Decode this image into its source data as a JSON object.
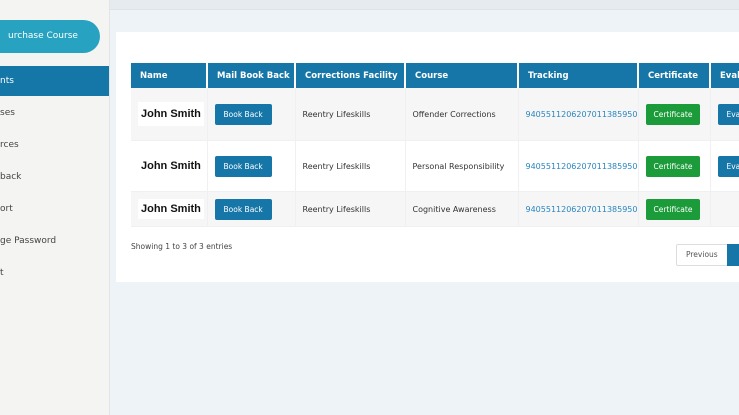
{
  "sidebar": {
    "purchase_label": "urchase Course",
    "items": [
      {
        "label": "nts",
        "active": true
      },
      {
        "label": "ses",
        "active": false
      },
      {
        "label": "rces",
        "active": false
      },
      {
        "label": "back",
        "active": false
      },
      {
        "label": "ort",
        "active": false
      },
      {
        "label": "ge Password",
        "active": false
      },
      {
        "label": "t",
        "active": false
      }
    ]
  },
  "table": {
    "headers": [
      "Name",
      "Mail Book Back",
      "Corrections Facility",
      "Course",
      "Tracking",
      "Certificate",
      "Eval"
    ],
    "rows": [
      {
        "name": "John Smith",
        "book_back": "Book Back",
        "facility": "Reentry Lifeskills",
        "course": "Offender Corrections",
        "tracking": "9405511206207011385950",
        "certificate": "Certificate",
        "eval": "Eval"
      },
      {
        "name": "John Smith",
        "book_back": "Book Back",
        "facility": "Reentry Lifeskills",
        "course": "Personal Responsibility",
        "tracking": "9405511206207011385950",
        "certificate": "Certificate",
        "eval": "Eval"
      },
      {
        "name": "John Smith",
        "book_back": "Book Back",
        "facility": "Reentry Lifeskills",
        "course": "Cognitive Awareness",
        "tracking": "9405511206207011385950",
        "certificate": "Certificate",
        "eval": ""
      }
    ]
  },
  "footer": {
    "entries_info": "Showing 1 to 3 of 3 entries",
    "previous_label": "Previous"
  },
  "colors": {
    "primary": "#1676a8",
    "accent": "#27a3c1",
    "success": "#1b9b3a",
    "link": "#2a86c0"
  }
}
